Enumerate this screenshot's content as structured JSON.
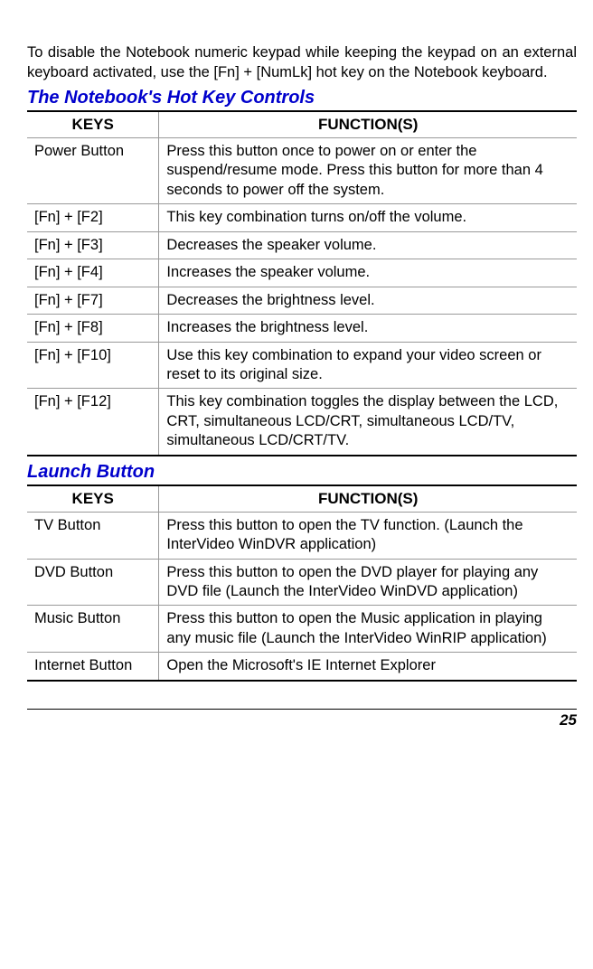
{
  "intro": "To disable the Notebook numeric keypad while keeping the keypad on an external keyboard activated, use the [Fn] + [NumLk] hot key on the Notebook keyboard.",
  "section1": {
    "heading": "The Notebook's Hot Key Controls",
    "col1": "KEYS",
    "col2": "FUNCTION(S)",
    "rows": [
      {
        "k": "Power Button",
        "f": "Press this button once to power on or enter the suspend/resume mode. Press this button for more than 4 seconds to power off the system."
      },
      {
        "k": "[Fn] + [F2]",
        "f": "This key combination turns on/off the volume."
      },
      {
        "k": "[Fn] + [F3]",
        "f": "Decreases the speaker volume."
      },
      {
        "k": "[Fn] + [F4]",
        "f": "Increases the speaker volume."
      },
      {
        "k": "[Fn] + [F7]",
        "f": "Decreases the brightness level."
      },
      {
        "k": "[Fn] + [F8]",
        "f": "Increases the brightness level."
      },
      {
        "k": "[Fn] + [F10]",
        "f": "Use this key combination to expand your video screen or reset to its original size."
      },
      {
        "k": "[Fn] + [F12]",
        "f": "This key combination toggles the display between the LCD, CRT, simultaneous LCD/CRT, simultaneous LCD/TV, simultaneous LCD/CRT/TV."
      }
    ]
  },
  "section2": {
    "heading": "Launch Button",
    "col1": "KEYS",
    "col2": "FUNCTION(S)",
    "rows": [
      {
        "k": "TV Button",
        "f": "Press this button to open the TV function. (Launch the InterVideo WinDVR application)"
      },
      {
        "k": "DVD Button",
        "f": "Press this button to open the DVD player for playing any DVD file (Launch the InterVideo WinDVD application)"
      },
      {
        "k": "Music Button",
        "f": "Press this button to open the Music application in playing any music file (Launch the InterVideo WinRIP application)"
      },
      {
        "k": "Internet Button",
        "f": "Open the Microsoft's IE Internet Explorer"
      }
    ]
  },
  "page_number": "25"
}
